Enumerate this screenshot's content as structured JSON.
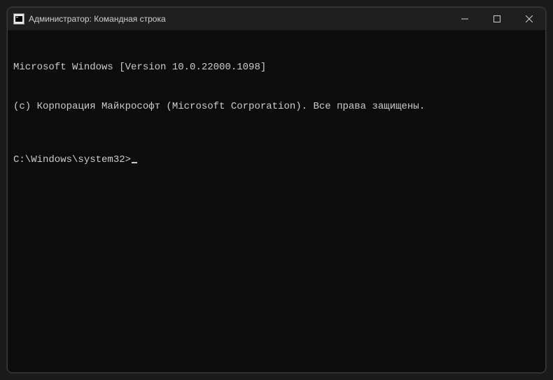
{
  "titlebar": {
    "title": "Администратор: Командная строка"
  },
  "terminal": {
    "line1": "Microsoft Windows [Version 10.0.22000.1098]",
    "line2": "(c) Корпорация Майкрософт (Microsoft Corporation). Все права защищены.",
    "prompt": "C:\\Windows\\system32>"
  }
}
